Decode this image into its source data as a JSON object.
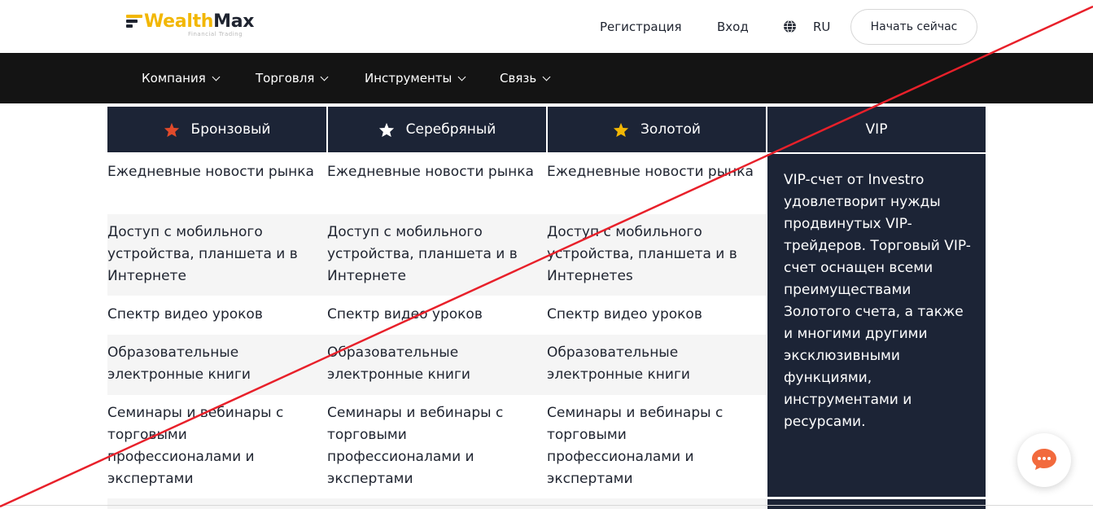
{
  "header": {
    "logo_brand_a": "Wealth",
    "logo_brand_b": "Max",
    "logo_tagline": "Financial Trading",
    "register_label": "Регистрация",
    "login_label": "Вход",
    "language": "RU",
    "cta_label": "Начать сейчас"
  },
  "menu": {
    "items": [
      {
        "label": "Компания"
      },
      {
        "label": "Торговля"
      },
      {
        "label": "Инструменты"
      },
      {
        "label": "Связь"
      }
    ]
  },
  "plans": {
    "headers": [
      {
        "label": "Бронзовый",
        "icon": "star-icon",
        "icon_color": "#e04a2b"
      },
      {
        "label": "Серебряный",
        "icon": "star-icon",
        "icon_color": "#ffffff"
      },
      {
        "label": "Золотой",
        "icon": "star-icon",
        "icon_color": "#f2b705"
      },
      {
        "label": "VIP"
      }
    ],
    "rows": [
      [
        "Ежедневные новости рынка",
        "Ежедневные новости рынка",
        "Ежедневные новости рынка"
      ],
      [
        "Доступ с мобильного устройства, планшета и в Интернете",
        "Доступ с мобильного устройства, планшета и в Интернете",
        "Доступ с мобильного устройства, планшета и в Интернетеs"
      ],
      [
        "Спектр видео уроков",
        "Спектр видео уроков",
        "Спектр видео уроков"
      ],
      [
        "Образовательные электронные книги",
        "Образовательные электронные книги",
        "Образовательные электронные книги"
      ],
      [
        "Семинары и вебинары с торговыми профессионалами и экспертами",
        "Семинары и вебинары с торговыми профессионалами и экспертами",
        "Семинары и вебинары с торговыми профессионалами и экспертами"
      ]
    ],
    "vip_description": "VIP-счет от Investro удовлетворит нужды продвинутых VIP-трейдеров. Торговый VIP-счет оснащен всеми преимуществами Золотого счета, а также и многими другими эксклюзивными функциями, инструментами и ресурсами."
  },
  "colors": {
    "header_dark": "#1c2436",
    "menubar": "#141414",
    "accent_gold": "#f2b705",
    "chat_orange": "#f26a3d",
    "strike_red": "#e8202a"
  }
}
